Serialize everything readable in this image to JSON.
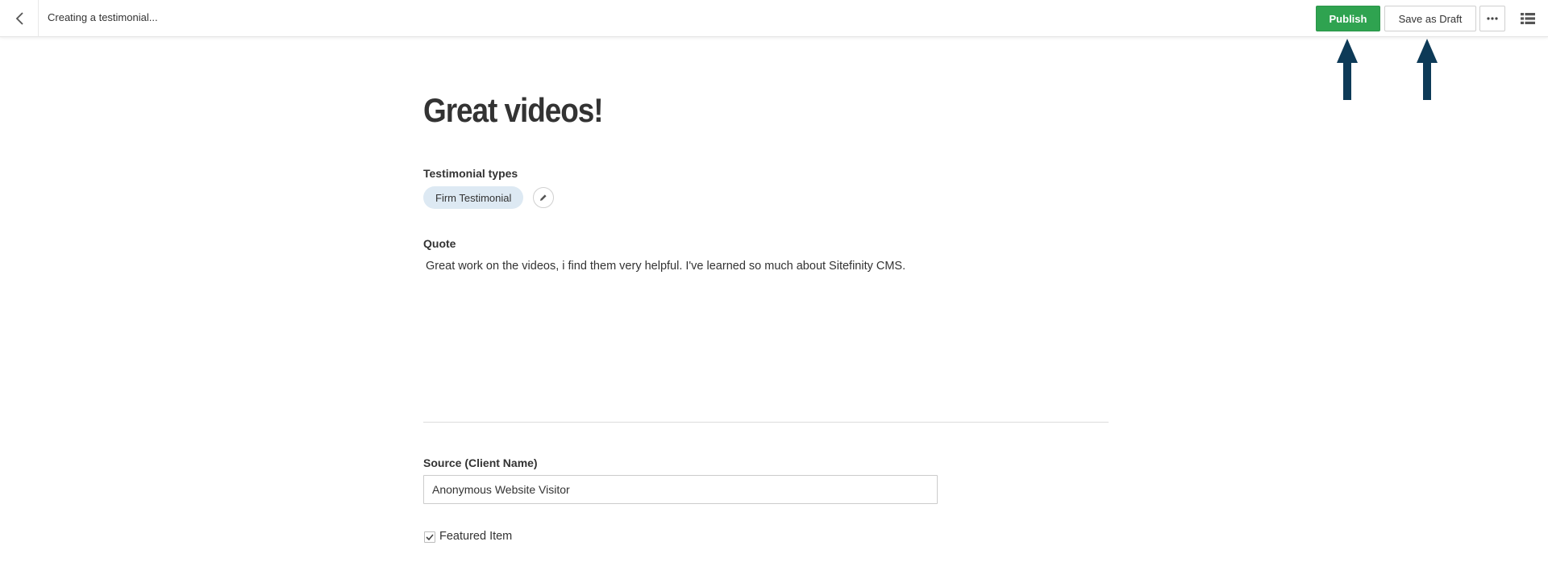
{
  "header": {
    "title": "Creating a testimonial...",
    "publish_label": "Publish",
    "save_draft_label": "Save as Draft",
    "icons": {
      "back": "chevron-left-icon",
      "more": "ellipsis-icon",
      "list": "list-view-icon"
    }
  },
  "content": {
    "title": "Great videos!",
    "testimonial_types": {
      "label": "Testimonial types",
      "chips": [
        "Firm Testimonial"
      ]
    },
    "quote": {
      "label": "Quote",
      "text": "Great work on the videos, i find them very helpful. I've learned so much about Sitefinity CMS."
    },
    "source": {
      "label": "Source (Client Name)",
      "value": "Anonymous Website Visitor"
    },
    "featured": {
      "label": "Featured Item",
      "checked": true
    }
  },
  "colors": {
    "publish": "#2fa350",
    "chip_background": "#dde9f3",
    "annotation_arrow": "#0d3a57"
  }
}
